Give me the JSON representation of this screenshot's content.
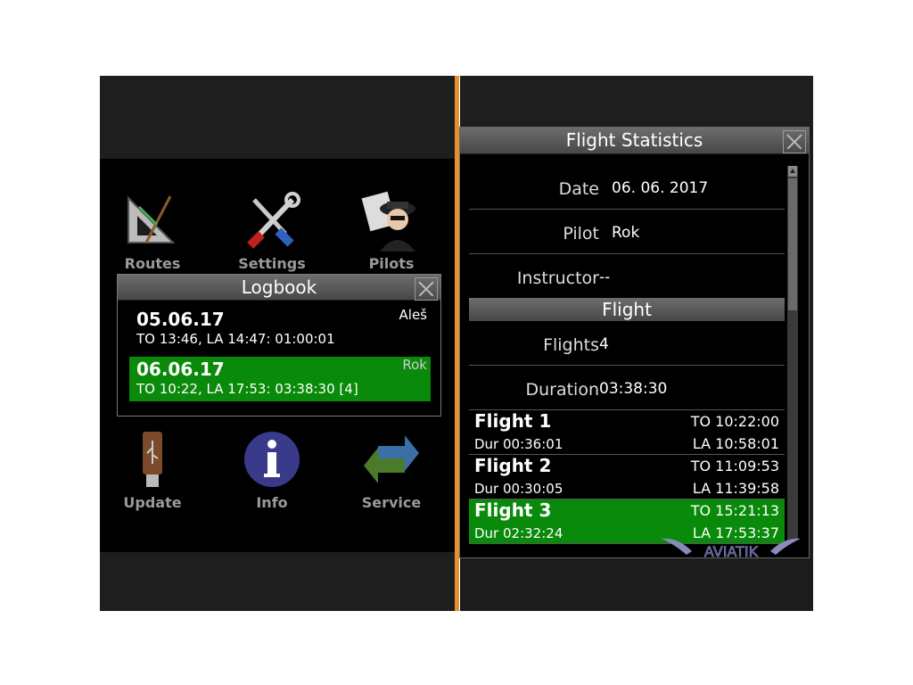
{
  "menu": {
    "routes": "Routes",
    "settings": "Settings",
    "pilots": "Pilots",
    "update": "Update",
    "info": "Info",
    "service": "Service"
  },
  "logbook": {
    "title": "Logbook",
    "entries": [
      {
        "date": "05.06.17",
        "pilot": "Aleš",
        "times": "TO 13:46, LA 14:47: 01:00:01"
      },
      {
        "date": "06.06.17",
        "pilot": "Rok",
        "times": "TO 10:22, LA 17:53: 03:38:30 [4]"
      }
    ]
  },
  "stats": {
    "title": "Flight Statistics",
    "date_label": "Date",
    "date_value": "06. 06. 2017",
    "pilot_label": "Pilot",
    "pilot_value": "Rok",
    "instructor_label": "Instructor",
    "instructor_value": "--",
    "section_flight": "Flight",
    "flights_label": "Flights",
    "flights_value": "4",
    "duration_label": "Duration",
    "duration_value": "03:38:30",
    "flights": [
      {
        "name": "Flight 1",
        "to": "TO 10:22:00",
        "dur": "Dur 00:36:01",
        "la": "LA 10:58:01"
      },
      {
        "name": "Flight 2",
        "to": "TO 11:09:53",
        "dur": "Dur 00:30:05",
        "la": "LA 11:39:58"
      },
      {
        "name": "Flight 3",
        "to": "TO 15:21:13",
        "dur": "Dur 02:32:24",
        "la": "LA 17:53:37"
      }
    ]
  },
  "logo": "AVIATIK",
  "colors": {
    "accent_divider": "#e8902a",
    "selected_green": "#0a8a0a"
  }
}
